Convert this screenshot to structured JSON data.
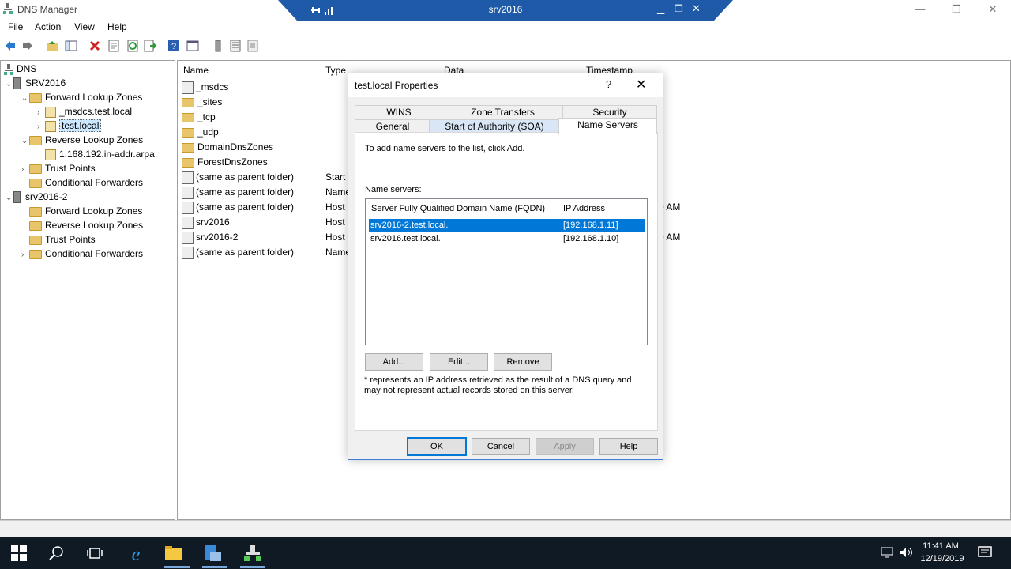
{
  "app": {
    "title": "DNS Manager"
  },
  "remote": {
    "title": "srv2016"
  },
  "window_buttons": {
    "minimize": "—",
    "restore": "❐",
    "close": "✕"
  },
  "menu": [
    "File",
    "Action",
    "View",
    "Help"
  ],
  "tree": {
    "root": "DNS",
    "srv1": "SRV2016",
    "fwd": "Forward Lookup Zones",
    "msdcs": "_msdcs.test.local",
    "testlocal": "test.local",
    "rev": "Reverse Lookup Zones",
    "arpa": "1.168.192.in-addr.arpa",
    "trust": "Trust Points",
    "cond": "Conditional Forwarders",
    "srv2": "srv2016-2",
    "fwd2": "Forward Lookup Zones",
    "rev2": "Reverse Lookup Zones",
    "trust2": "Trust Points",
    "cond2": "Conditional Forwarders"
  },
  "list": {
    "columns": [
      "Name",
      "Type",
      "Data",
      "Timestamp"
    ],
    "rows": [
      {
        "name": "_msdcs",
        "type": "",
        "time": ""
      },
      {
        "name": "_sites",
        "type": "",
        "time": ""
      },
      {
        "name": "_tcp",
        "type": "",
        "time": ""
      },
      {
        "name": "_udp",
        "type": "",
        "time": ""
      },
      {
        "name": "DomainDnsZones",
        "type": "",
        "time": ""
      },
      {
        "name": "ForestDnsZones",
        "type": "",
        "time": ""
      },
      {
        "name": "(same as parent folder)",
        "type": "Start",
        "time": ""
      },
      {
        "name": "(same as parent folder)",
        "type": "Name",
        "time": ""
      },
      {
        "name": "(same as parent folder)",
        "type": "Host",
        "time": "0 AM"
      },
      {
        "name": "srv2016",
        "type": "Host",
        "time": ""
      },
      {
        "name": "srv2016-2",
        "type": "Host",
        "time": "0 AM"
      },
      {
        "name": "(same as parent folder)",
        "type": "Name",
        "time": ""
      }
    ]
  },
  "dialog": {
    "title": "test.local Properties",
    "help_glyph": "?",
    "close_glyph": "✕",
    "tabs_row1": [
      "WINS",
      "Zone Transfers",
      "Security"
    ],
    "tabs_row2": [
      "General",
      "Start of Authority (SOA)",
      "Name Servers"
    ],
    "instruction": "To add name servers to the list, click Add.",
    "ns_label": "Name servers:",
    "ns_columns": [
      "Server Fully Qualified Domain Name (FQDN)",
      "IP Address"
    ],
    "ns_rows": [
      {
        "fqdn": "srv2016-2.test.local.",
        "ip": "[192.168.1.11]",
        "selected": true
      },
      {
        "fqdn": "srv2016.test.local.",
        "ip": "[192.168.1.10]",
        "selected": false
      }
    ],
    "add": "Add...",
    "edit": "Edit...",
    "remove": "Remove",
    "note": "* represents an IP address retrieved as the result of a DNS query and may not represent actual records stored on this server.",
    "ok": "OK",
    "cancel": "Cancel",
    "apply": "Apply",
    "help": "Help"
  },
  "taskbar": {
    "time": "11:41 AM",
    "date": "12/19/2019"
  },
  "colors": {
    "accent": "#0078d7",
    "rdbar": "#1e5aa8",
    "taskbar": "#101a24",
    "selection": "#0078d7"
  }
}
